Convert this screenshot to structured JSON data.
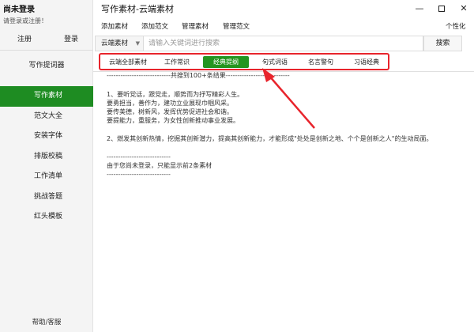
{
  "sidebar": {
    "user_status": "尚未登录",
    "user_hint": "请登录或注册！",
    "register_label": "注册",
    "login_label": "登录",
    "top_item": "写作提词器",
    "items": [
      "写作素材",
      "范文大全",
      "安装字体",
      "排版校稿",
      "工作清单",
      "挑战答题",
      "红头模板"
    ],
    "active_item": "写作素材",
    "help_label": "帮助/客服"
  },
  "window": {
    "title": "写作素材-云端素材",
    "min_glyph": "—",
    "close_glyph": "✕"
  },
  "menu": {
    "items": [
      "添加素材",
      "添加范文",
      "管理素材",
      "管理范文"
    ],
    "right_item": "个性化"
  },
  "search": {
    "type_label": "云端素材",
    "placeholder": "请输入关键词进行搜索",
    "value": "",
    "button_label": "搜索"
  },
  "tabs": {
    "items": [
      "云端全部素材",
      "工作常识",
      "经典提纲",
      "句式词语",
      "名言警句",
      "习语经典"
    ],
    "active": "经典提纲",
    "highlight_color": "#e8242c",
    "active_color": "#23951f"
  },
  "content": {
    "result_line": "----------------------------共搜到100+条结果----------------------------",
    "block1": [
      "1、要听党话，跟党走，顺势而为抒写精彩人生。",
      "要勇担当，善作为，建功立业展现巾帼风采。",
      "要传美德，树新风，发挥优势促进社会和谐。",
      "要提能力，重服务，为女性创新推动事业发展。"
    ],
    "block2": "2、燃发其创新热情，挖掘其创新潜力，提高其创新能力，才能形成\"处处是创新之地、个个是创新之人\"的生动局面。",
    "block3": [
      "----------------------------",
      "由于您尚未登录，只能显示前2条素材",
      "----------------------------"
    ]
  }
}
